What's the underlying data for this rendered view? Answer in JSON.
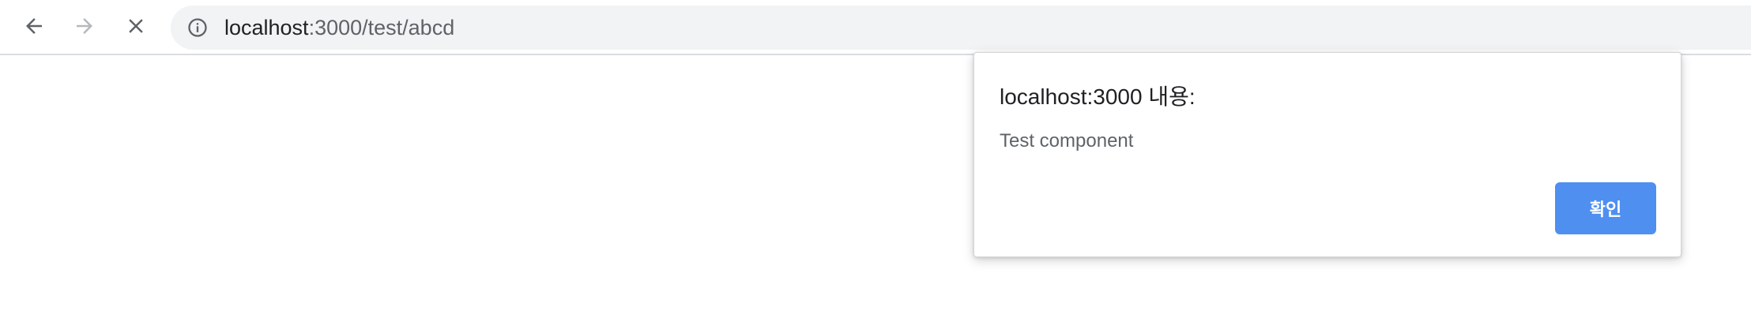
{
  "browser": {
    "back_icon": "arrow-left-icon",
    "forward_icon": "arrow-right-icon",
    "stop_icon": "close-icon",
    "info_icon": "info-icon",
    "url_host": "localhost",
    "url_rest": ":3000/test/abcd",
    "colors": {
      "omnibox_bg": "#f1f3f4",
      "url_host": "#202124",
      "url_rest": "#5f6368"
    }
  },
  "alert": {
    "title": "localhost:3000 내용:",
    "message": "Test component",
    "ok_label": "확인",
    "colors": {
      "button_bg": "#4f8ff0",
      "button_text": "#ffffff"
    }
  }
}
